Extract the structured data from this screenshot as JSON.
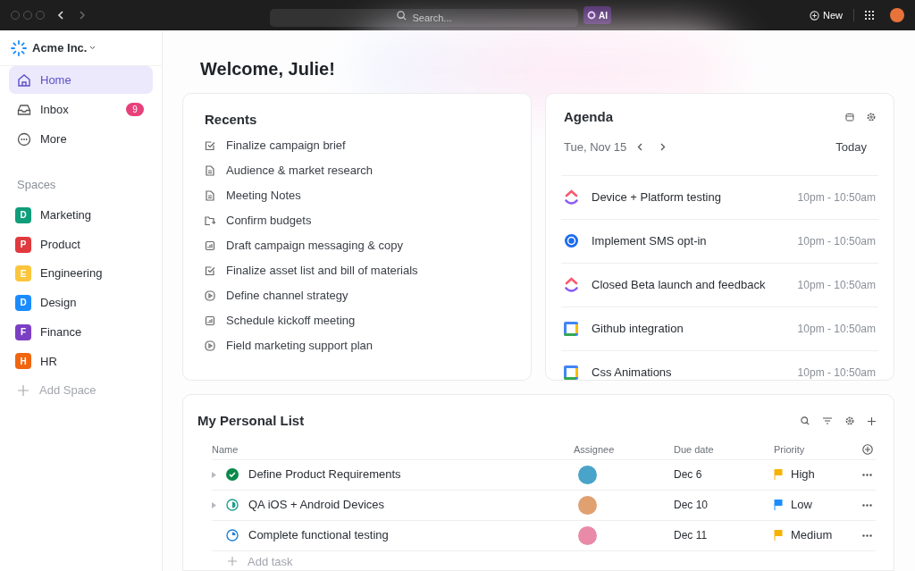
{
  "topbar": {
    "search_placeholder": "Search...",
    "ai": "AI",
    "new": "New"
  },
  "workspace": "Acme Inc.",
  "nav": [
    {
      "kind": "home",
      "label": "Home",
      "selected": true
    },
    {
      "kind": "inbox",
      "label": "Inbox",
      "selected": false,
      "badge": "9"
    },
    {
      "kind": "more",
      "label": "More",
      "selected": false
    }
  ],
  "spaces_heading": "Spaces",
  "spaces": [
    {
      "letter": "D",
      "name": "Marketing",
      "color": "#0f9d7a"
    },
    {
      "letter": "P",
      "name": "Product",
      "color": "#e0393e"
    },
    {
      "letter": "E",
      "name": "Engineering",
      "color": "#fbc63d"
    },
    {
      "letter": "D",
      "name": "Design",
      "color": "#1a8cff"
    },
    {
      "letter": "F",
      "name": "Finance",
      "color": "#7b3fc4"
    },
    {
      "letter": "H",
      "name": "HR",
      "color": "#f0650e"
    }
  ],
  "add_space": "Add Space",
  "welcome": "Welcome, Julie!",
  "recents": {
    "title": "Recents",
    "items": [
      {
        "kind": "task",
        "label": "Finalize campaign brief"
      },
      {
        "kind": "doc",
        "label": "Audience & market research"
      },
      {
        "kind": "doc",
        "label": "Meeting Notes"
      },
      {
        "kind": "folder",
        "label": "Confirm budgets"
      },
      {
        "kind": "dashboard",
        "label": "Draft campaign messaging & copy"
      },
      {
        "kind": "task",
        "label": "Finalize asset list and bill of materials"
      },
      {
        "kind": "video",
        "label": "Define channel strategy"
      },
      {
        "kind": "dashboard",
        "label": "Schedule kickoff meeting"
      },
      {
        "kind": "video",
        "label": "Field marketing support plan"
      }
    ]
  },
  "agenda": {
    "title": "Agenda",
    "date": "Tue, Nov 15",
    "today": "Today",
    "events": [
      {
        "kind": "clickup",
        "title": "Device + Platform testing",
        "time": "10pm - 10:50am"
      },
      {
        "kind": "calendly",
        "title": "Implement SMS opt-in",
        "time": "10pm - 10:50am"
      },
      {
        "kind": "clickup",
        "title": "Closed Beta launch and feedback",
        "time": "10pm - 10:50am"
      },
      {
        "kind": "gcal",
        "title": "Github integration",
        "time": "10pm - 10:50am"
      },
      {
        "kind": "gcal",
        "title": "Css Animations",
        "time": "10pm - 10:50am"
      }
    ]
  },
  "list": {
    "title": "My Personal List",
    "columns": [
      "Name",
      "Assignee",
      "Due date",
      "Priority"
    ],
    "rows": [
      {
        "expandable": true,
        "kind": "done",
        "name": "Define Product Requirements",
        "due": "Dec 6",
        "priority": "High",
        "color": "#f5b300"
      },
      {
        "expandable": true,
        "kind": "in_progress",
        "name": "QA iOS + Android Devices",
        "due": "Dec 10",
        "priority": "Low",
        "color": "#1a8cff"
      },
      {
        "expandable": false,
        "kind": "started",
        "name": "Complete functional testing",
        "due": "Dec 11",
        "priority": "Medium",
        "color": "#f5b300"
      }
    ],
    "add_task": "Add task"
  }
}
